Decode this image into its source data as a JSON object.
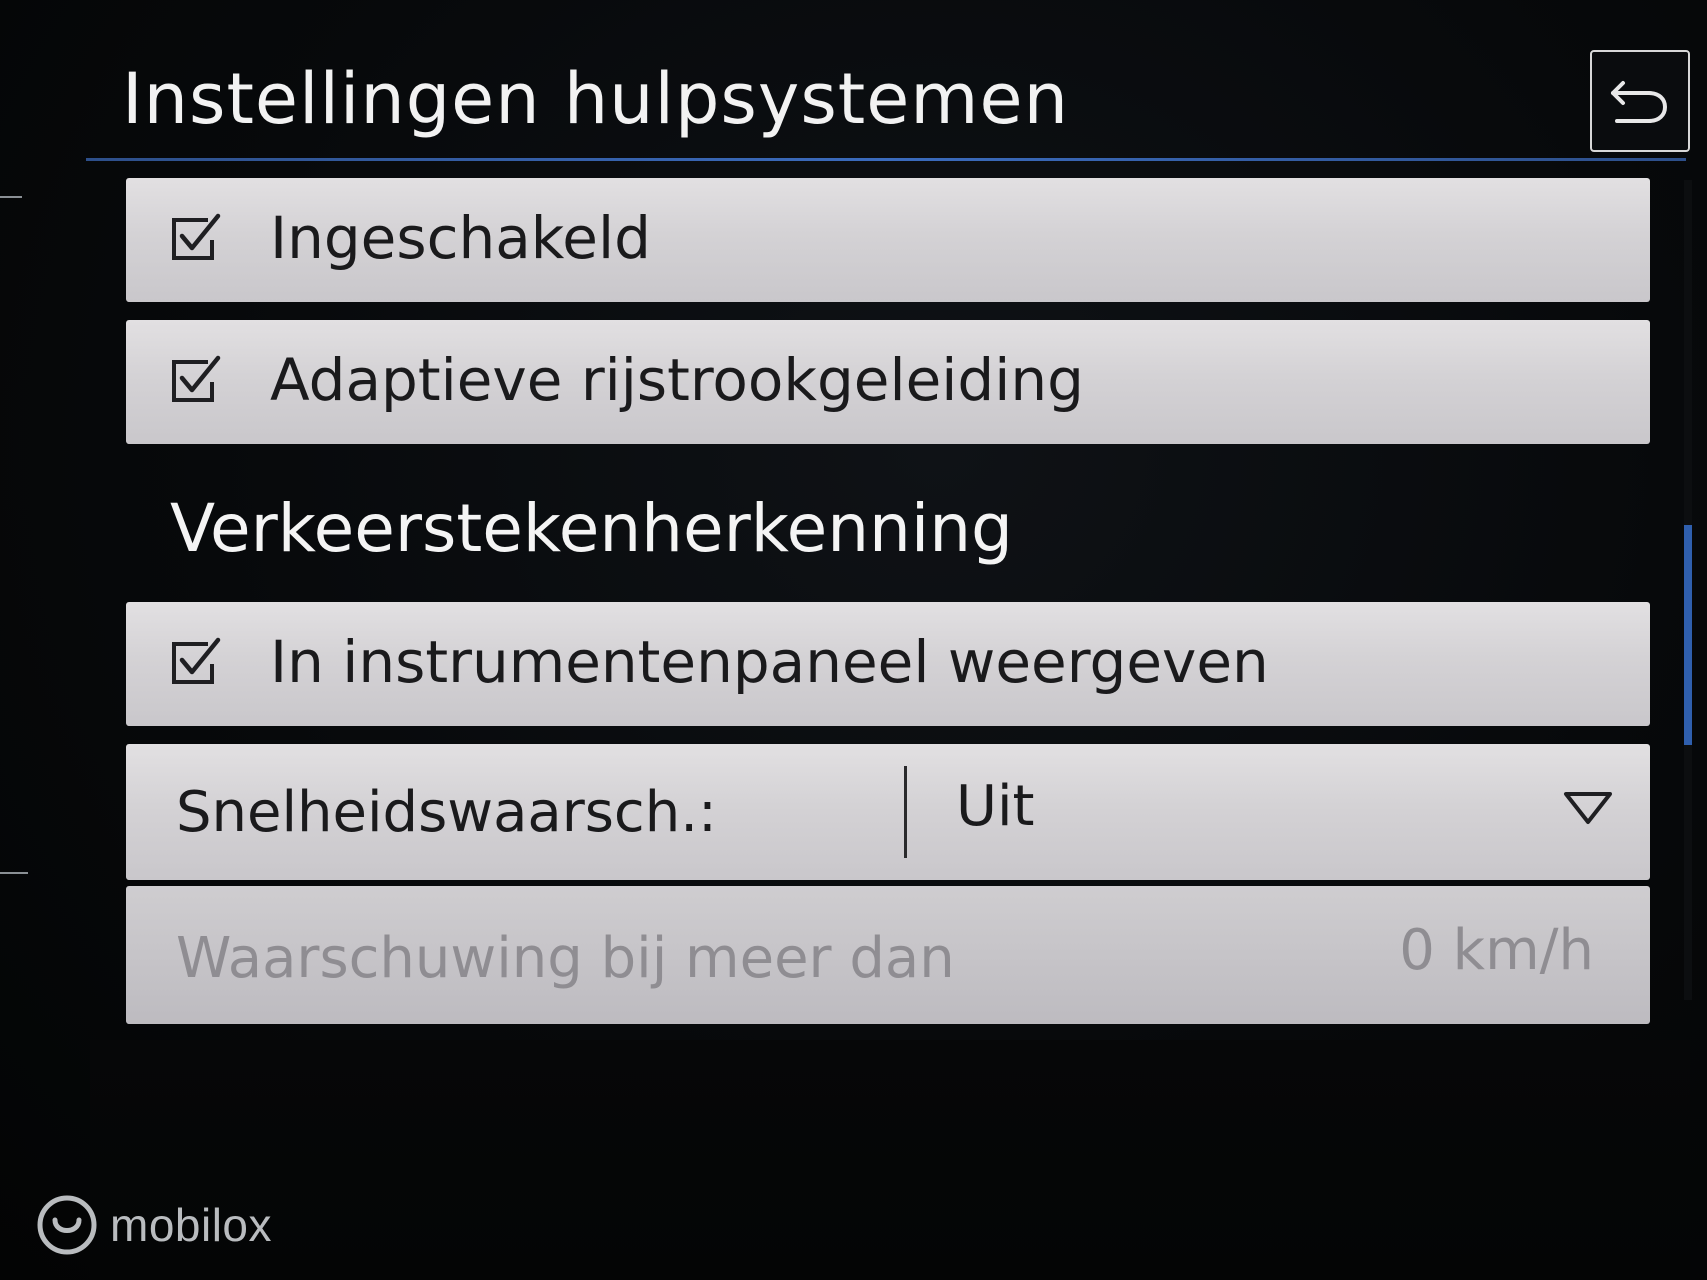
{
  "header": {
    "title": "Instellingen hulpsystemen",
    "back_icon": "back-arrow-icon"
  },
  "options": [
    {
      "label": "Ingeschakeld",
      "checked": true,
      "icon": "checkbox-checked-icon"
    },
    {
      "label": "Adaptieve rijstrookgeleiding",
      "checked": true,
      "icon": "checkbox-checked-icon"
    }
  ],
  "section": {
    "heading": "Verkeerstekenherkenning",
    "option": {
      "label": "In instrumentenpaneel weergeven",
      "checked": true,
      "icon": "checkbox-checked-icon"
    },
    "speed_warning": {
      "label": "Snelheidswaarsch.:",
      "value": "Uit",
      "icon": "dropdown-triangle-icon"
    },
    "threshold": {
      "label": "Waarschuwing bij meer dan",
      "value": "0 km/h",
      "enabled": false
    }
  },
  "watermark": {
    "text": "mobilox"
  },
  "colors": {
    "accent": "#3b6bbd",
    "row_background": "#d4d2d5",
    "disabled_text": "#8f8d92"
  }
}
